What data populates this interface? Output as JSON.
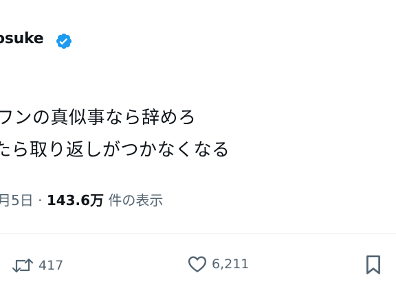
{
  "tweet": {
    "author_name": "osuke",
    "handle": "_",
    "text_line1": "ワンの真似事なら辞めろ",
    "text_line2": "たら取り返しがつかなくなる",
    "date": "月5日",
    "separator": " · ",
    "views_count": "143.6万",
    "views_label": " 件の表示"
  },
  "actions": {
    "retweet_count": "417",
    "like_count": "6,211"
  },
  "colors": {
    "verified": "#1d9bf0",
    "secondary_text": "#536471",
    "primary_text": "#0f1419"
  },
  "icons": [
    "verified-badge-icon",
    "retweet-icon",
    "like-icon",
    "bookmark-icon"
  ]
}
